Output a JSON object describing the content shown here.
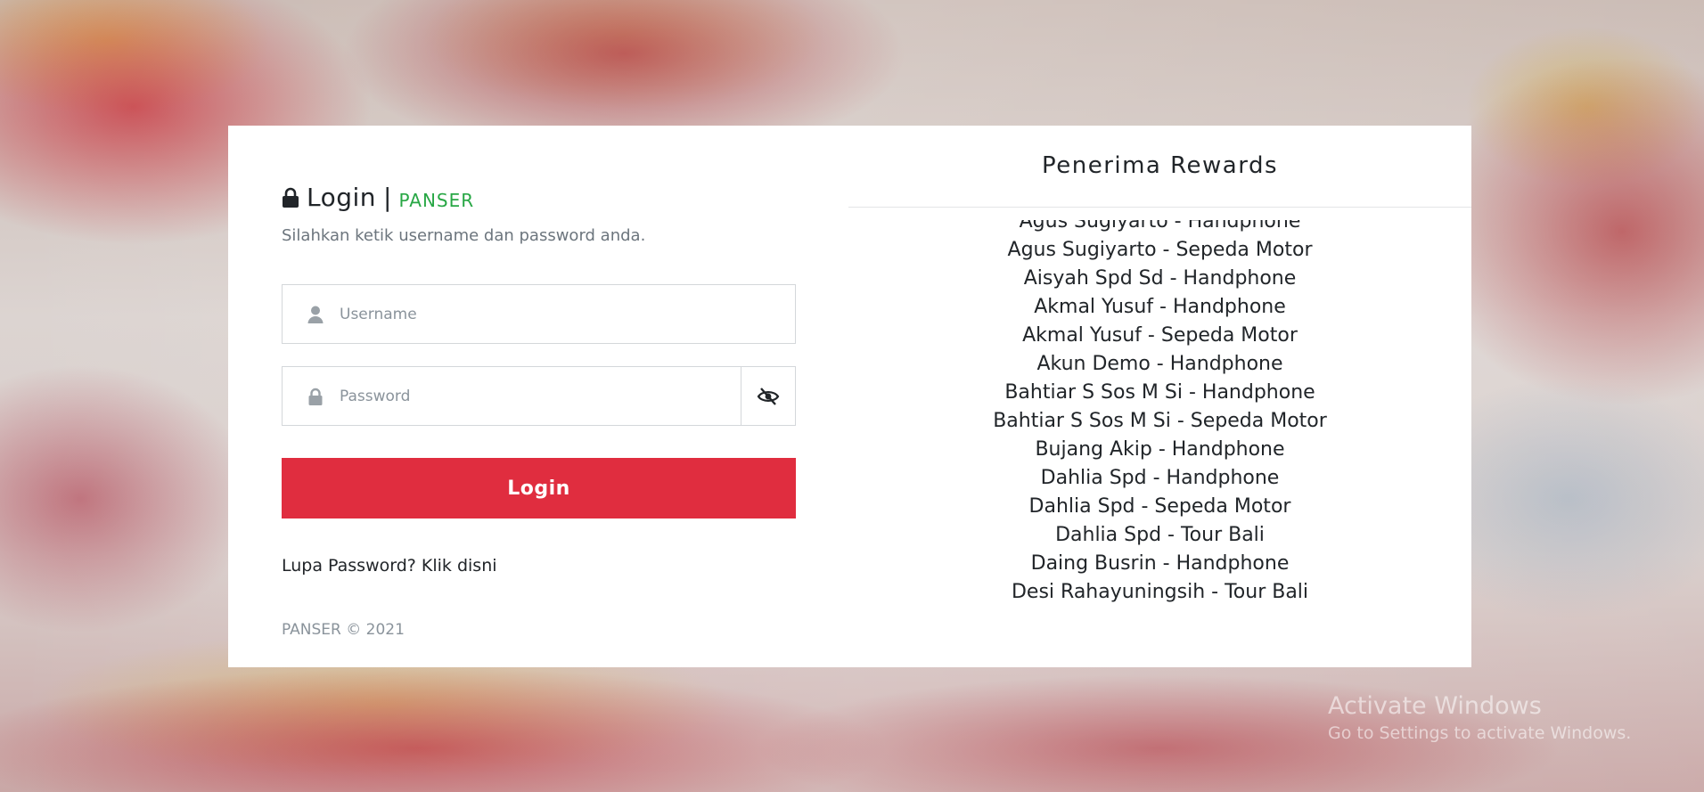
{
  "login": {
    "title": "Login",
    "separator": "|",
    "brand": "PANSER",
    "subtitle": "Silahkan ketik username dan password anda.",
    "username_placeholder": "Username",
    "password_placeholder": "Password",
    "button_label": "Login",
    "forgot_link": "Lupa Password? Klik disni",
    "copyright": "PANSER © 2021"
  },
  "rewards": {
    "title": "Penerima Rewards",
    "items": [
      "Agus Sugiyarto - Handphone",
      "Agus Sugiyarto - Sepeda Motor",
      "Aisyah Spd Sd - Handphone",
      "Akmal Yusuf - Handphone",
      "Akmal Yusuf - Sepeda Motor",
      "Akun Demo - Handphone",
      "Bahtiar S Sos M Si - Handphone",
      "Bahtiar S Sos M Si - Sepeda Motor",
      "Bujang Akip - Handphone",
      "Dahlia Spd - Handphone",
      "Dahlia Spd - Sepeda Motor",
      "Dahlia Spd - Tour Bali",
      "Daing Busrin - Handphone",
      "Desi Rahayuningsih - Tour Bali"
    ]
  },
  "watermark": {
    "title": "Activate Windows",
    "subtitle": "Go to Settings to activate Windows."
  },
  "colors": {
    "accent_red": "#e02d3f",
    "brand_green": "#28a745"
  },
  "icons": {
    "lock": "lock-icon",
    "user": "user-icon",
    "password_lock": "lock-icon",
    "toggle": "eye-slash-icon"
  }
}
